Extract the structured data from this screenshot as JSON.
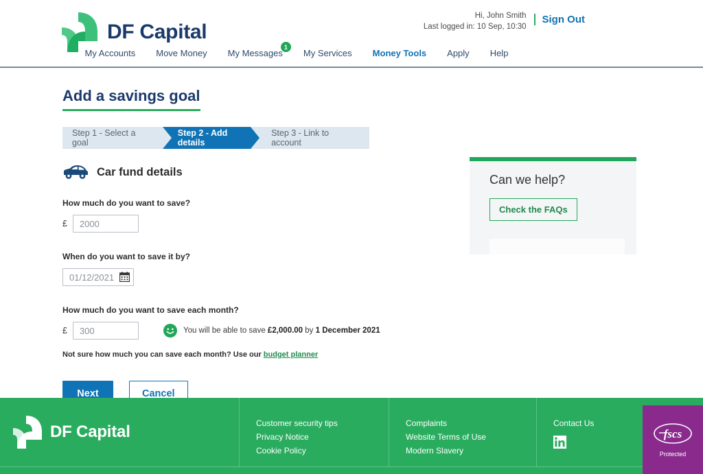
{
  "header": {
    "brand": "DF Capital",
    "greeting": "Hi, John Smith",
    "last_login": "Last logged in: 10 Sep, 10:30",
    "sign_out": "Sign Out",
    "nav": [
      {
        "label": "My Accounts",
        "active": false,
        "badge": ""
      },
      {
        "label": "Move Money",
        "active": false,
        "badge": ""
      },
      {
        "label": "My Messages",
        "active": false,
        "badge": "1"
      },
      {
        "label": "My Services",
        "active": false,
        "badge": ""
      },
      {
        "label": "Money Tools",
        "active": true,
        "badge": ""
      },
      {
        "label": "Apply",
        "active": false,
        "badge": ""
      },
      {
        "label": "Help",
        "active": false,
        "badge": ""
      }
    ]
  },
  "main": {
    "page_title": "Add a savings goal",
    "steps": [
      {
        "label": "Step 1 - Select a goal",
        "state": "complete"
      },
      {
        "label": "Step 2 - Add details",
        "state": "active"
      },
      {
        "label": "Step 3 - Link to account",
        "state": "upcoming"
      }
    ],
    "fund_title": "Car fund details",
    "amount": {
      "label": "How much do you want to save?",
      "currency": "£",
      "value": "2000",
      "placeholder": "2000"
    },
    "date": {
      "label": "When do you want to save it by?",
      "value": "01/12/2021",
      "placeholder": "01/12/2021"
    },
    "monthly": {
      "label": "How much do you want to save each month?",
      "currency": "£",
      "value": "300",
      "placeholder": "300",
      "message_prefix": "You will be able to save ",
      "message_amount": "£2,000.00",
      "message_middle": " by ",
      "message_date": "1 December 2021"
    },
    "hint_text": "Not sure how much you can save each month? Use our ",
    "hint_link": "budget planner",
    "next_label": "Next",
    "cancel_label": "Cancel"
  },
  "help": {
    "title": "Can we help?",
    "faq_label": "Check the FAQs"
  },
  "footer": {
    "brand": "DF Capital",
    "col1": [
      "Customer security tips",
      "Privacy Notice",
      "Cookie Policy"
    ],
    "col2": [
      "Complaints",
      "Website Terms of Use",
      "Modern Slavery"
    ],
    "contact_heading": "Contact Us",
    "fscs_label": "Protected"
  },
  "colors": {
    "brand_green": "#2aac5f",
    "brand_navy": "#1b3a6b",
    "accent_blue": "#1073b5",
    "fscs_purple": "#8a2a8c",
    "step_bg": "#dde7ef"
  }
}
